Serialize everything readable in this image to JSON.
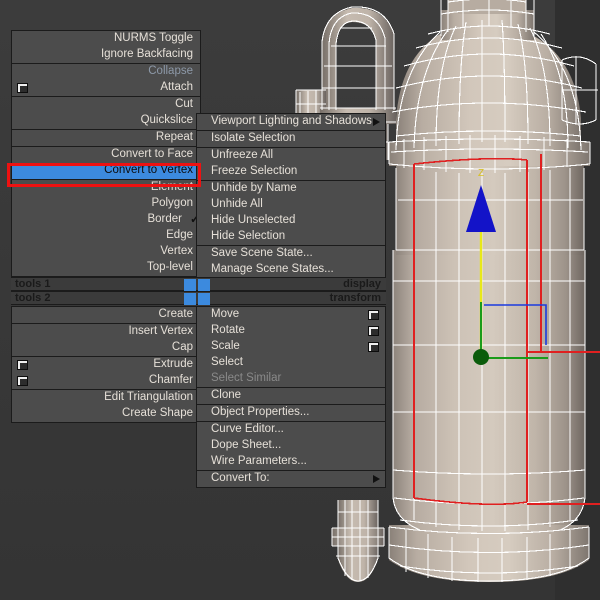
{
  "app": {
    "accent_selected": "#3c8ade",
    "highlight_outline": "#ee1111",
    "menu_bg": "#4c4c4c",
    "menu_text": "#e6e0d8",
    "disabled_text": "#8d99a8",
    "viewport_bg": "#383838",
    "model_fill": "#c3b8ac",
    "wire_color": "#ffffff",
    "selection_edge": "#e02020"
  },
  "quad_menu": {
    "title_bars": [
      {
        "left_label": "tools 1",
        "right_label": "display"
      },
      {
        "left_label": "tools 2",
        "right_label": "transform"
      }
    ],
    "tools1_upper": {
      "groups": [
        {
          "items": [
            {
              "label": "NURMS Toggle",
              "state": "normal",
              "dialog_box": false,
              "checked": false
            },
            {
              "label": "Ignore Backfacing",
              "state": "normal",
              "dialog_box": false,
              "checked": false
            }
          ]
        },
        {
          "items": [
            {
              "label": "Collapse",
              "state": "disabled",
              "dialog_box": false,
              "checked": false
            },
            {
              "label": "Attach",
              "state": "normal",
              "dialog_box": true,
              "checked": false
            }
          ]
        },
        {
          "items": [
            {
              "label": "Cut",
              "state": "normal",
              "dialog_box": false,
              "checked": false
            },
            {
              "label": "Quickslice",
              "state": "normal",
              "dialog_box": false,
              "checked": false
            }
          ]
        },
        {
          "items": [
            {
              "label": "Repeat",
              "state": "normal",
              "dialog_box": false,
              "checked": false
            }
          ]
        },
        {
          "items": [
            {
              "label": "Convert to Face",
              "state": "normal",
              "dialog_box": false,
              "checked": false
            },
            {
              "label": "Convert to Vertex",
              "state": "selected",
              "dialog_box": false,
              "checked": false
            }
          ]
        },
        {
          "items": [
            {
              "label": "Element",
              "state": "normal",
              "dialog_box": false,
              "checked": false
            },
            {
              "label": "Polygon",
              "state": "normal",
              "dialog_box": false,
              "checked": false
            },
            {
              "label": "Border",
              "state": "normal",
              "dialog_box": false,
              "checked": true
            },
            {
              "label": "Edge",
              "state": "normal",
              "dialog_box": false,
              "checked": false
            },
            {
              "label": "Vertex",
              "state": "normal",
              "dialog_box": false,
              "checked": false
            },
            {
              "label": "Top-level",
              "state": "normal",
              "dialog_box": false,
              "checked": false
            }
          ]
        }
      ]
    },
    "tools2_lower": {
      "groups": [
        {
          "items": [
            {
              "label": "Create",
              "state": "normal",
              "dialog_box": false
            }
          ]
        },
        {
          "items": [
            {
              "label": "Insert Vertex",
              "state": "normal",
              "dialog_box": false
            },
            {
              "label": "Cap",
              "state": "normal",
              "dialog_box": false
            }
          ]
        },
        {
          "items": [
            {
              "label": "Extrude",
              "state": "normal",
              "dialog_box": true
            },
            {
              "label": "Chamfer",
              "state": "normal",
              "dialog_box": true
            }
          ]
        },
        {
          "items": [
            {
              "label": "Edit Triangulation",
              "state": "normal",
              "dialog_box": false
            },
            {
              "label": "Create Shape",
              "state": "normal",
              "dialog_box": false
            }
          ]
        }
      ]
    },
    "display_upper": {
      "groups": [
        {
          "items": [
            {
              "label": "Viewport Lighting and Shadows",
              "state": "normal",
              "submenu": true,
              "dialog_box": false
            }
          ]
        },
        {
          "items": [
            {
              "label": "Isolate Selection",
              "state": "normal",
              "submenu": false,
              "dialog_box": false
            }
          ]
        },
        {
          "items": [
            {
              "label": "Unfreeze All",
              "state": "normal",
              "submenu": false,
              "dialog_box": false
            },
            {
              "label": "Freeze Selection",
              "state": "normal",
              "submenu": false,
              "dialog_box": false
            }
          ]
        },
        {
          "items": [
            {
              "label": "Unhide by Name",
              "state": "normal",
              "submenu": false,
              "dialog_box": false
            },
            {
              "label": "Unhide All",
              "state": "normal",
              "submenu": false,
              "dialog_box": false
            },
            {
              "label": "Hide Unselected",
              "state": "normal",
              "submenu": false,
              "dialog_box": false
            },
            {
              "label": "Hide Selection",
              "state": "normal",
              "submenu": false,
              "dialog_box": false
            }
          ]
        },
        {
          "items": [
            {
              "label": "Save Scene State...",
              "state": "normal",
              "submenu": false,
              "dialog_box": false
            },
            {
              "label": "Manage Scene States...",
              "state": "normal",
              "submenu": false,
              "dialog_box": false
            }
          ]
        }
      ]
    },
    "transform_lower": {
      "groups": [
        {
          "items": [
            {
              "label": "Move",
              "state": "normal",
              "submenu": false,
              "dialog_box": true
            },
            {
              "label": "Rotate",
              "state": "normal",
              "submenu": false,
              "dialog_box": true
            },
            {
              "label": "Scale",
              "state": "normal",
              "submenu": false,
              "dialog_box": true
            },
            {
              "label": "Select",
              "state": "normal",
              "submenu": false,
              "dialog_box": false
            },
            {
              "label": "Select Similar",
              "state": "disabled2",
              "submenu": false,
              "dialog_box": false
            }
          ]
        },
        {
          "items": [
            {
              "label": "Clone",
              "state": "normal",
              "submenu": false,
              "dialog_box": false
            }
          ]
        },
        {
          "items": [
            {
              "label": "Object Properties...",
              "state": "normal",
              "submenu": false,
              "dialog_box": false
            }
          ]
        },
        {
          "items": [
            {
              "label": "Curve Editor...",
              "state": "normal",
              "submenu": false,
              "dialog_box": false
            },
            {
              "label": "Dope Sheet...",
              "state": "normal",
              "submenu": false,
              "dialog_box": false
            },
            {
              "label": "Wire Parameters...",
              "state": "normal",
              "submenu": false,
              "dialog_box": false
            }
          ]
        },
        {
          "items": [
            {
              "label": "Convert To:",
              "state": "normal",
              "submenu": true,
              "dialog_box": false
            }
          ]
        }
      ]
    }
  },
  "viewport": {
    "name": "perspective-viewport",
    "gizmo": {
      "type": "move-gizmo",
      "axis_label": "Z",
      "axis_label_color": "#d8c020",
      "z_arrow_color": "#1313c8",
      "x_axis_color": "#d01010",
      "y_axis_color": "#1a9b1a",
      "origin_color": "#0b5c0b"
    },
    "model": {
      "name": "fire-extinguisher-mesh",
      "subobject_selection": "border",
      "selected_edge_color": "#e02020"
    }
  }
}
